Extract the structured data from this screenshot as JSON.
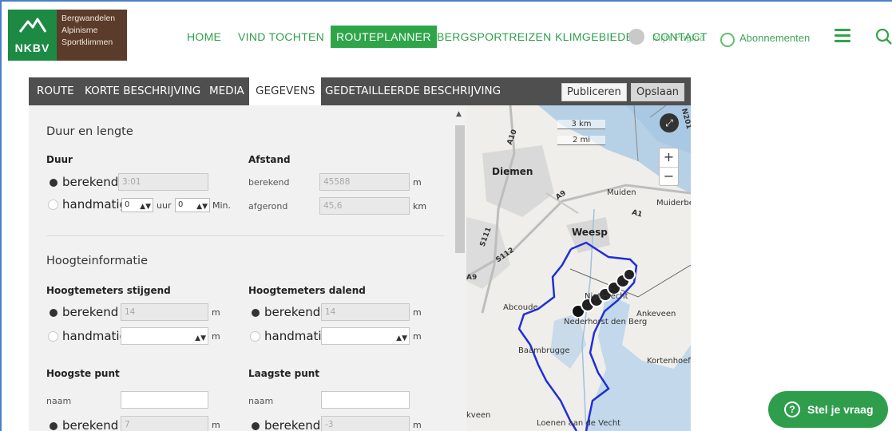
{
  "header": {
    "logo_text": "NKBV",
    "tagline": [
      "Bergwandelen",
      "Alpinisme",
      "Sportklimmen"
    ],
    "menu": [
      {
        "label": "HOME",
        "active": false
      },
      {
        "label": "VIND TOCHTEN",
        "active": false
      },
      {
        "label": "ROUTEPLANNER",
        "active": true
      },
      {
        "label": "BERGSPORTREIZEN",
        "active": false
      },
      {
        "label": "KLIMGEBIEDEN",
        "active": false
      },
      {
        "label": "CONTACT",
        "active": false
      }
    ],
    "profile_label": "Mijn Pagina",
    "subscriptions_label": "Abonnementen",
    "brand_color": "#2fa54a"
  },
  "editor": {
    "tabs": [
      {
        "label": "ROUTE",
        "active": false
      },
      {
        "label": "KORTE BESCHRIJVING",
        "active": false
      },
      {
        "label": "MEDIA",
        "active": false
      },
      {
        "label": "GEGEVENS",
        "active": true
      },
      {
        "label": "GEDETAILLEERDE BESCHRIJVING",
        "active": false
      }
    ],
    "publish_label": "Publiceren",
    "save_label": "Opslaan"
  },
  "form": {
    "duration_length_title": "Duur en lengte",
    "duration": {
      "label": "Duur",
      "calculated_label": "berekend",
      "calculated_value": "3:01",
      "manual_label": "handmatig",
      "hours_value": "0",
      "hours_unit": "uur",
      "minutes_value": "0",
      "minutes_unit": "Min."
    },
    "distance": {
      "label": "Afstand",
      "calculated_label": "berekend",
      "calculated_value": "45588",
      "calculated_unit": "m",
      "rounded_label": "afgerond",
      "rounded_value": "45,6",
      "rounded_unit": "km"
    },
    "height_title": "Hoogteinformatie",
    "ascent": {
      "label": "Hoogtemeters stijgend",
      "calculated_label": "berekend",
      "calculated_value": "14",
      "manual_label": "handmatig",
      "unit": "m"
    },
    "descent": {
      "label": "Hoogtemeters dalend",
      "calculated_label": "berekend",
      "calculated_value": "14",
      "manual_label": "handmatig",
      "unit": "m"
    },
    "highest": {
      "label": "Hoogste punt",
      "name_label": "naam",
      "calculated_label": "berekend",
      "calculated_value": "7",
      "unit": "m"
    },
    "lowest": {
      "label": "Laagste punt",
      "name_label": "naam",
      "calculated_label": "berekend",
      "calculated_value": "-3",
      "unit": "m"
    }
  },
  "map": {
    "scale_km": "3 km",
    "scale_mi": "2 mi",
    "places": [
      "Diemen",
      "Muiden",
      "Muiderberg",
      "Weesp",
      "Nigtevecht",
      "Nederhorst den Berg",
      "Ankeveen",
      "Abcoude",
      "Baambrugge",
      "Kortenhoef",
      "Loenen aan de Vecht",
      "kveen"
    ],
    "roads": [
      "A10",
      "A9",
      "A1",
      "S111",
      "S112",
      "N201"
    ],
    "zoom_in": "+",
    "zoom_out": "−",
    "route_color": "#1f2fd8"
  },
  "help": {
    "chat_label": "Stel je vraag",
    "chat_icon": "?"
  }
}
